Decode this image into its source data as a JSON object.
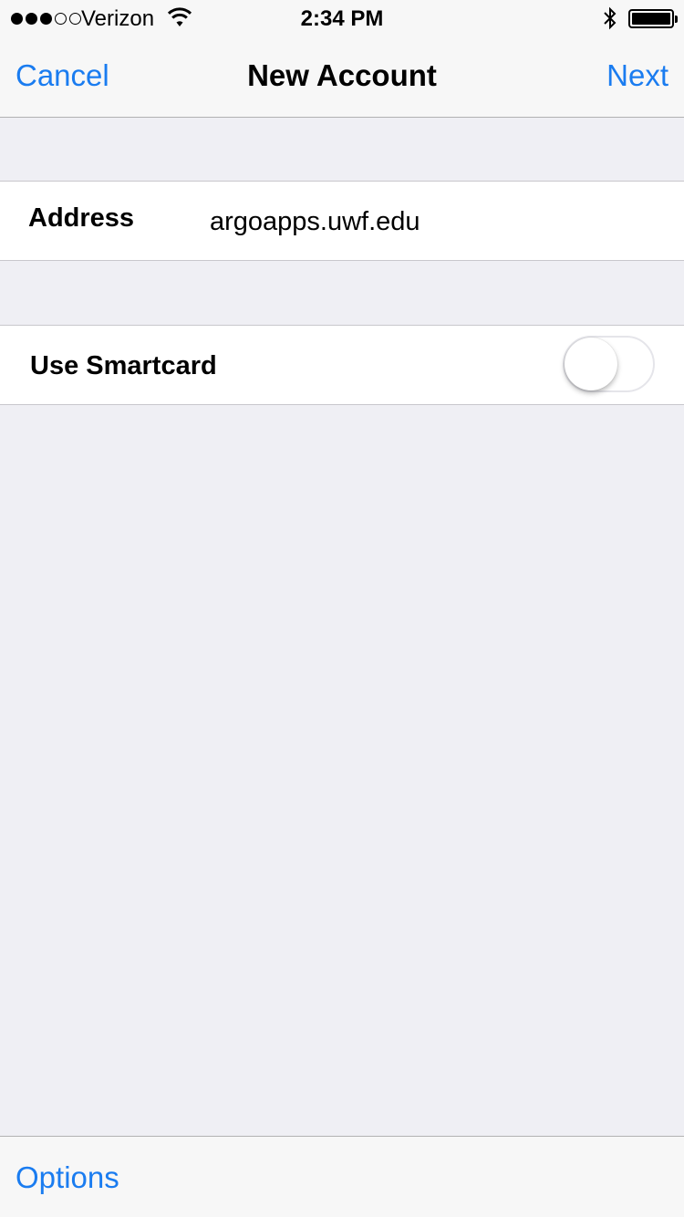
{
  "status_bar": {
    "carrier": "Verizon",
    "time": "2:34 PM",
    "signal_bars_filled": 3,
    "signal_bars_total": 5
  },
  "nav": {
    "cancel_label": "Cancel",
    "title": "New Account",
    "next_label": "Next"
  },
  "address": {
    "label": "Address",
    "value": "argoapps.uwf.edu"
  },
  "smartcard": {
    "label": "Use Smartcard",
    "enabled": false
  },
  "toolbar": {
    "options_label": "Options"
  },
  "colors": {
    "accent": "#1a7cf0",
    "background": "#efeff4",
    "chrome": "#f7f7f7"
  },
  "icons": [
    "wifi-icon",
    "bluetooth-icon",
    "battery-icon"
  ]
}
